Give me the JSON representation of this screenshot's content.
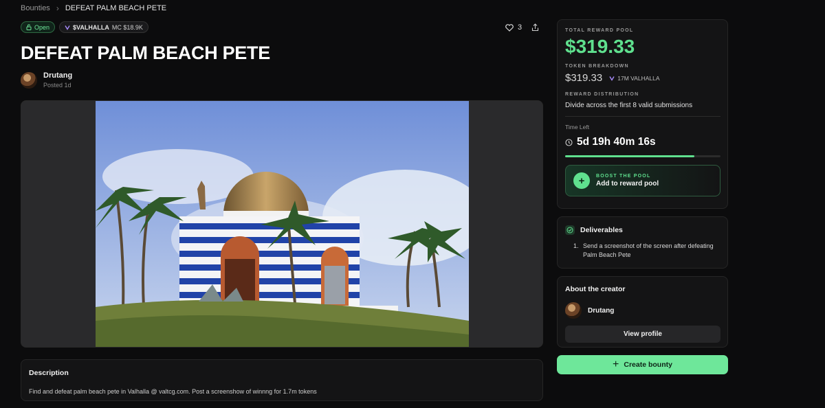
{
  "breadcrumb": {
    "root": "Bounties",
    "current": "DEFEAT PALM BEACH PETE"
  },
  "badges": {
    "status": "Open",
    "token_symbol": "$VALHALLA",
    "market_cap": "MC $18.9K"
  },
  "likes": "3",
  "bounty": {
    "title": "DEFEAT PALM BEACH PETE",
    "author": "Drutang",
    "posted": "Posted 1d"
  },
  "description": {
    "heading": "Description",
    "text": "Find and defeat palm beach pete in Valhalla @ valtcg.com. Post a screenshow of winnng for 1.7m tokens"
  },
  "reward": {
    "pool_label": "TOTAL REWARD POOL",
    "pool_value": "$319.33",
    "breakdown_label": "TOKEN BREAKDOWN",
    "breakdown_usd": "$319.33",
    "breakdown_tokens": "17M VALHALLA",
    "distribution_label": "REWARD DISTRIBUTION",
    "distribution_text": "Divide across the first 8 valid submissions",
    "time_label": "Time Left",
    "time_value": "5d 19h 40m 16s",
    "time_progress": 0.83,
    "boost_label": "BOOST THE POOL",
    "boost_action": "Add to reward pool"
  },
  "deliverables": {
    "heading": "Deliverables",
    "items": [
      "Send a screenshot of the screen after defeating Palm Beach Pete"
    ]
  },
  "creator": {
    "heading": "About the creator",
    "name": "Drutang",
    "button": "View profile"
  },
  "create_button": "Create bounty",
  "colors": {
    "accent": "#5fe08e",
    "background": "#0c0c0d",
    "card": "#141415"
  }
}
